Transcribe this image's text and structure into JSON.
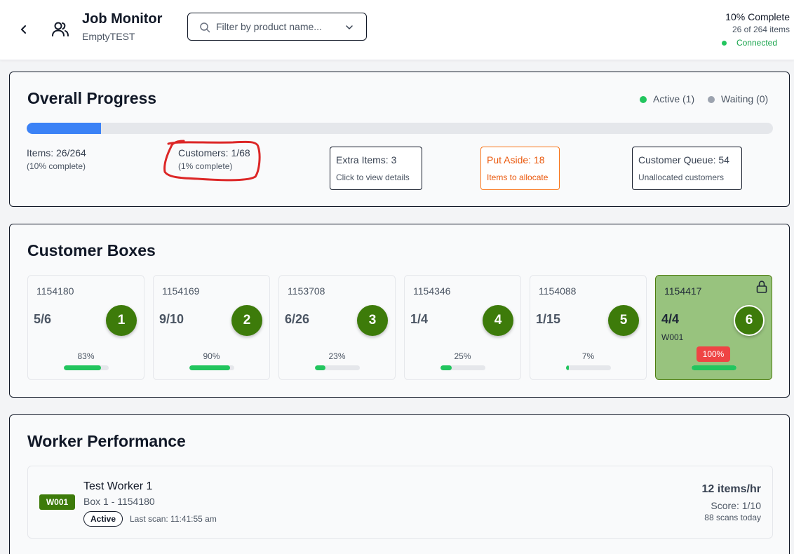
{
  "header": {
    "title": "Job Monitor",
    "subtitle": "EmptyTEST",
    "filter_placeholder": "Filter by product name...",
    "complete_text": "10% Complete",
    "items_text": "26 of 264 items",
    "connection": "Connected",
    "icons": {
      "back": "chevron-left-icon",
      "users": "users-icon",
      "search": "search-icon",
      "dropdown": "chevron-down-icon"
    }
  },
  "overall": {
    "title": "Overall Progress",
    "legend_active": "Active (1)",
    "legend_waiting": "Waiting (0)",
    "progress_fraction": 0.1,
    "items": {
      "main": "Items: 26/264",
      "sub": "(10% complete)"
    },
    "customers": {
      "main": "Customers: 1/68",
      "sub": "(1% complete)"
    },
    "extra": {
      "title": "Extra Items: 3",
      "sub": "Click to view details"
    },
    "put_aside": {
      "title": "Put Aside: 18",
      "sub": "Items to allocate"
    },
    "queue": {
      "title": "Customer Queue: 54",
      "sub": "Unallocated customers"
    }
  },
  "customer_boxes": {
    "title": "Customer Boxes",
    "boxes": [
      {
        "id": "1154180",
        "count": "5/6",
        "number": "1",
        "pct": "83%",
        "fill": 0.83
      },
      {
        "id": "1154169",
        "count": "9/10",
        "number": "2",
        "pct": "90%",
        "fill": 0.9
      },
      {
        "id": "1153708",
        "count": "6/26",
        "number": "3",
        "pct": "23%",
        "fill": 0.23
      },
      {
        "id": "1154346",
        "count": "1/4",
        "number": "4",
        "pct": "25%",
        "fill": 0.25
      },
      {
        "id": "1154088",
        "count": "1/15",
        "number": "5",
        "pct": "7%",
        "fill": 0.07
      },
      {
        "id": "1154417",
        "count": "4/4",
        "number": "6",
        "pct": "100%",
        "fill": 1.0,
        "worker": "W001",
        "locked": true
      }
    ]
  },
  "workers": {
    "title": "Worker Performance",
    "rows": [
      {
        "badge": "W001",
        "name": "Test Worker 1",
        "box": "Box 1 - 1154180",
        "status": "Active",
        "last_scan": "Last scan: 11:41:55 am",
        "rate": "12 items/hr",
        "score": "Score: 1/10",
        "scans": "88 scans today"
      }
    ]
  },
  "colors": {
    "accent_blue": "#3b82f6",
    "green": "#3d7b0a",
    "success": "#22c55e",
    "orange": "#ea580c",
    "danger": "#ef4444",
    "annotation_red": "#dc2626"
  }
}
